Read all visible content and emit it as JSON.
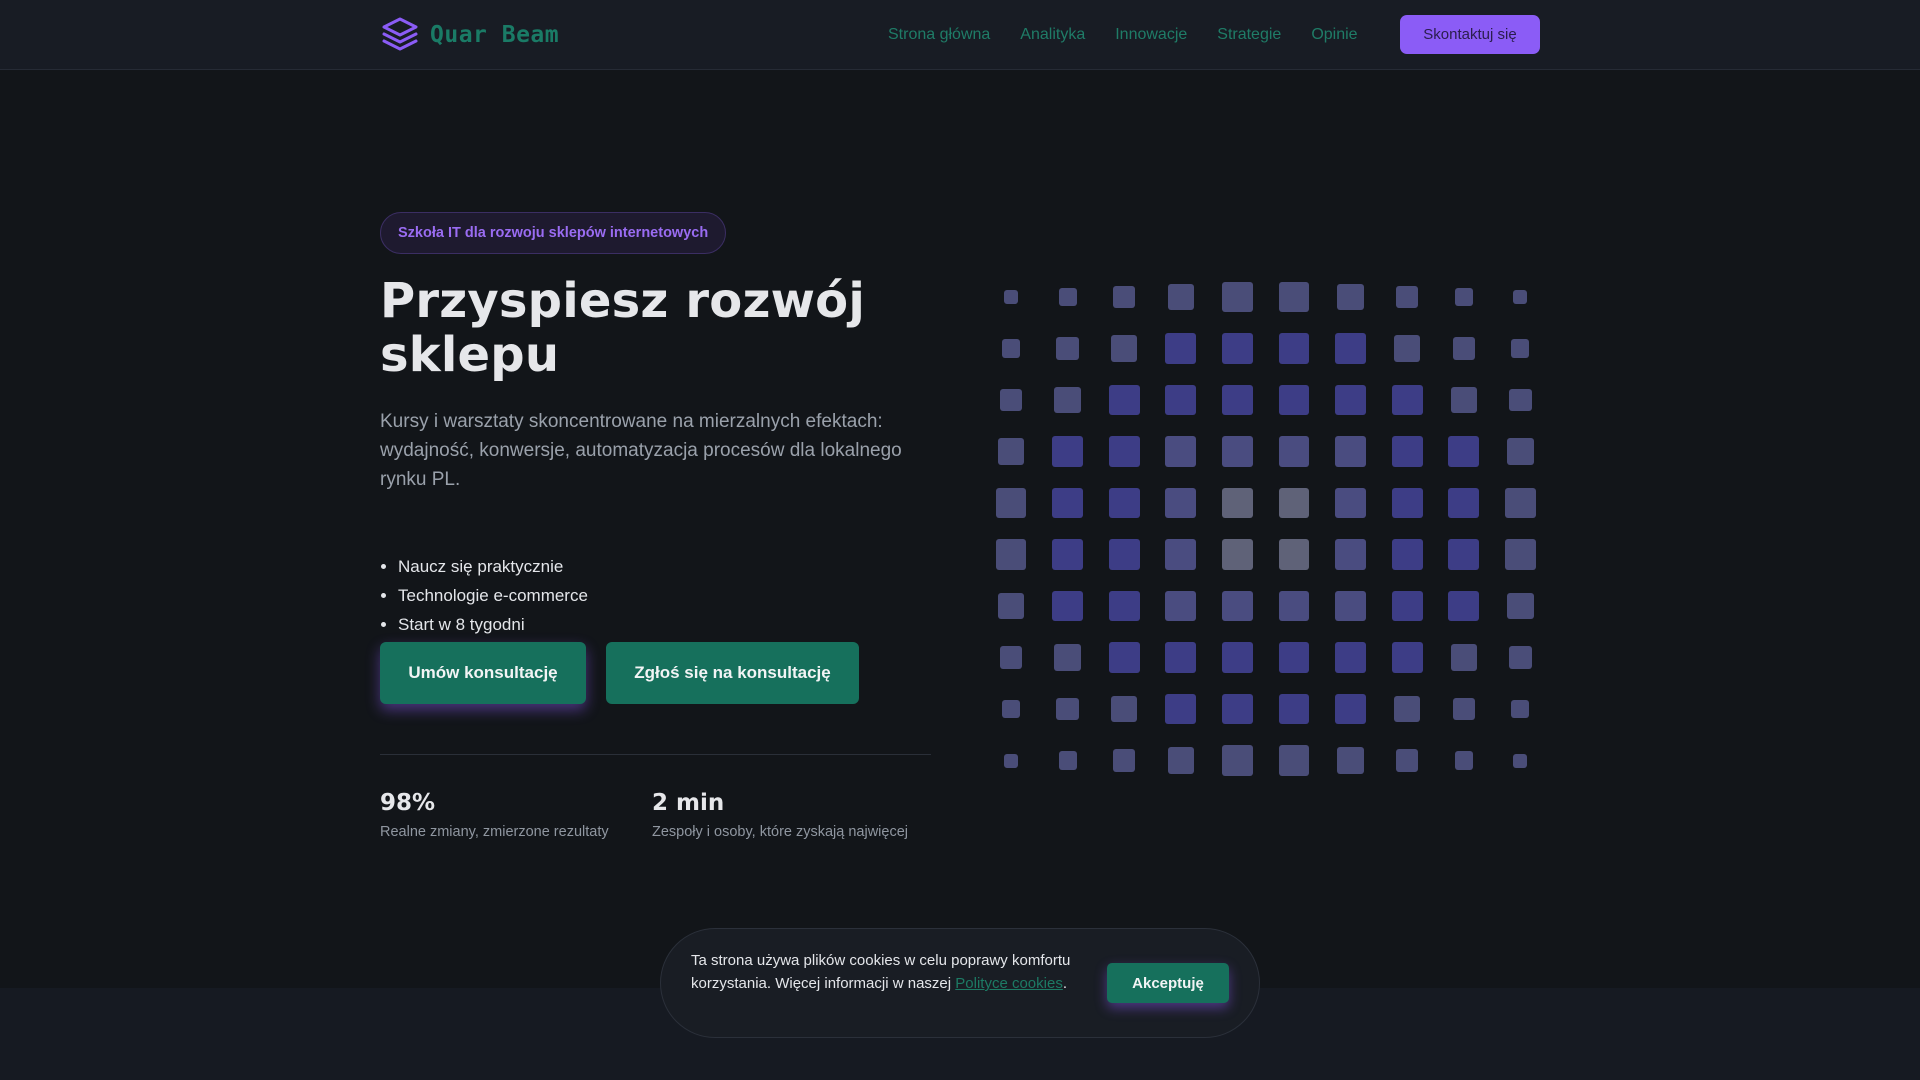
{
  "brand": {
    "name": "Quar Beam",
    "logo_icon": "layers-icon",
    "accent_color": "#8b5cf6",
    "brand_color": "#16705c"
  },
  "nav": {
    "items": [
      {
        "label": "Strona główna"
      },
      {
        "label": "Analityka"
      },
      {
        "label": "Innowacje"
      },
      {
        "label": "Strategie"
      },
      {
        "label": "Opinie"
      }
    ],
    "cta_label": "Skontaktuj się"
  },
  "hero": {
    "badge": "Szkoła IT dla rozwoju sklepów internetowych",
    "title": "Przyspiesz rozwój sklepu",
    "subtitle": "Kursy i warsztaty skoncentrowane na mierzalnych efektach: wydajność, konwersje, automatyzacja procesów dla lokalnego rynku PL.",
    "features": [
      "Naucz się praktycznie",
      "Technologie e-commerce",
      "Start w 8 tygodni"
    ],
    "primary_button": "Umów konsultację",
    "secondary_button": "Zgłoś się na konsultację"
  },
  "stats": [
    {
      "value": "98%",
      "label": "Realne zmiany, zmierzone rezultaty"
    },
    {
      "value": "2 min",
      "label": "Zespoły i osoby, które zyskają najwięcej"
    }
  ],
  "cookie": {
    "text_before": "Ta strona używa plików cookies w celu poprawy komfortu korzystania. Więcej informacji w naszej ",
    "link_text": "Polityce cookies",
    "text_after": ".",
    "accept_label": "Akceptuję"
  }
}
